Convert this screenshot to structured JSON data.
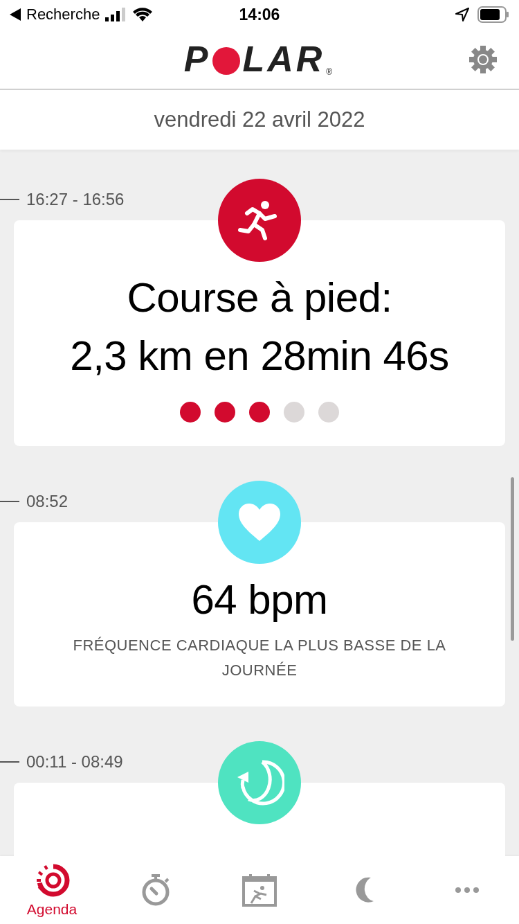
{
  "status_bar": {
    "back_label": "Recherche",
    "time": "14:06"
  },
  "header": {
    "logo_left": "P",
    "logo_right": "LAR",
    "logo_mark": "®"
  },
  "date": "vendredi 22 avril 2022",
  "entries": [
    {
      "kind": "run",
      "time": "16:27 - 16:56",
      "title_lines": [
        "Course à pied:",
        "2,3 km en 28min 46s"
      ],
      "intensity_dots": [
        {
          "filled": true
        },
        {
          "filled": true
        },
        {
          "filled": true
        },
        {
          "filled": false
        },
        {
          "filled": false
        }
      ]
    },
    {
      "kind": "heart",
      "time": "08:52",
      "title_lines": [
        "64 bpm"
      ],
      "caption": "FRÉQUENCE CARDIAQUE LA PLUS BASSE DE LA JOURNÉE"
    },
    {
      "kind": "sleep",
      "time": "00:11 - 08:49"
    }
  ],
  "tabs": [
    {
      "kind": "agenda",
      "label": "Agenda",
      "selected": true
    },
    {
      "kind": "stopwatch",
      "selected": false
    },
    {
      "kind": "calendar",
      "selected": false
    },
    {
      "kind": "moon",
      "selected": false
    },
    {
      "kind": "more",
      "selected": false
    }
  ]
}
